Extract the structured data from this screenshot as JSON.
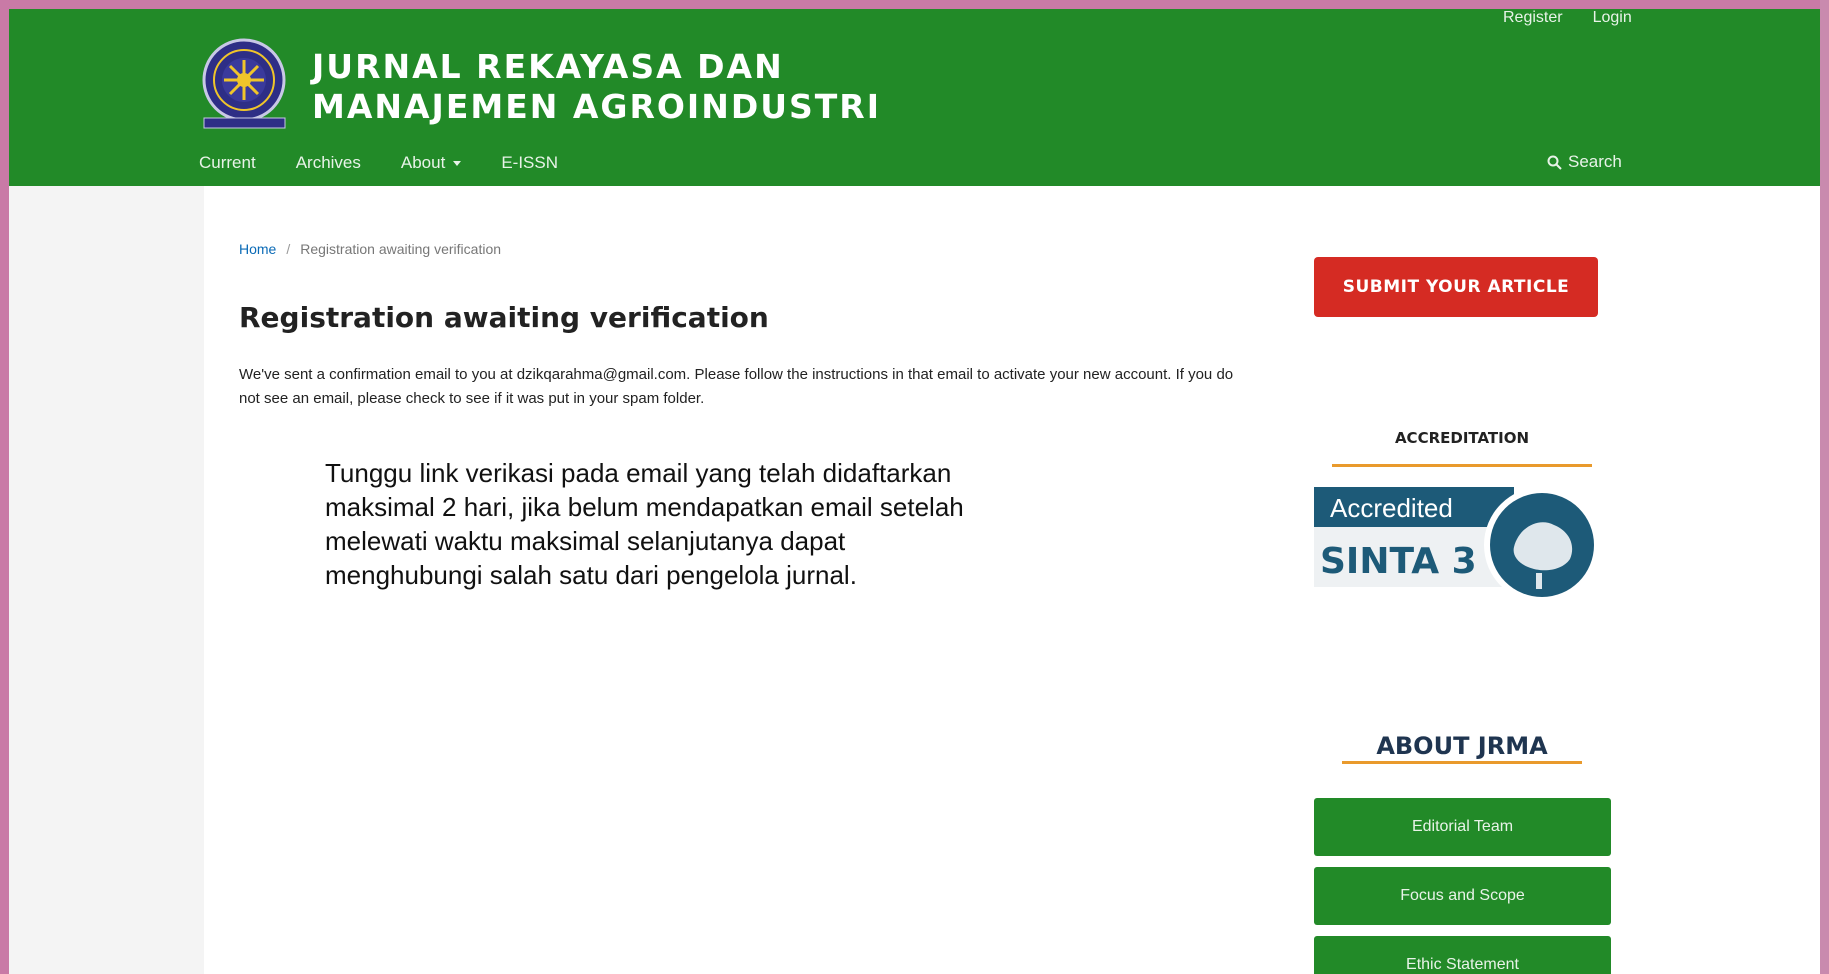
{
  "user_nav": {
    "register": "Register",
    "login": "Login"
  },
  "site": {
    "title_line1": "JURNAL REKAYASA DAN",
    "title_line2": "MANAJEMEN AGROINDUSTRI"
  },
  "main_nav": {
    "items": [
      {
        "label": "Current"
      },
      {
        "label": "Archives"
      },
      {
        "label": "About"
      },
      {
        "label": "E-ISSN"
      }
    ],
    "search": "Search"
  },
  "breadcrumb": {
    "home": "Home",
    "separator": "/",
    "current": "Registration awaiting verification"
  },
  "main": {
    "title": "Registration awaiting verification",
    "message": "We've sent a confirmation email to you at dzikqarahma@gmail.com. Please follow the instructions in that email to activate your new account. If you do not see an email, please check to see if it was put in your spam folder.",
    "note": "Tunggu link verikasi pada email yang telah didaftarkan maksimal 2 hari, jika belum mendapatkan email setelah melewati waktu maksimal selanjutanya dapat menghubungi salah satu dari pengelola jurnal."
  },
  "sidebar": {
    "submit_label": "SUBMIT YOUR ARTICLE",
    "accreditation_title": "ACCREDITATION",
    "badge": {
      "line1": "Accredited",
      "line2": "SINTA 3"
    },
    "about_title": "ABOUT JRMA",
    "buttons": [
      {
        "label": "Editorial Team"
      },
      {
        "label": "Focus and Scope"
      },
      {
        "label": "Ethic Statement"
      }
    ]
  },
  "colors": {
    "header_green": "#228a28",
    "submit_red": "#d52b23",
    "accent_orange": "#e99a2c",
    "badge_teal": "#1d5a78"
  }
}
